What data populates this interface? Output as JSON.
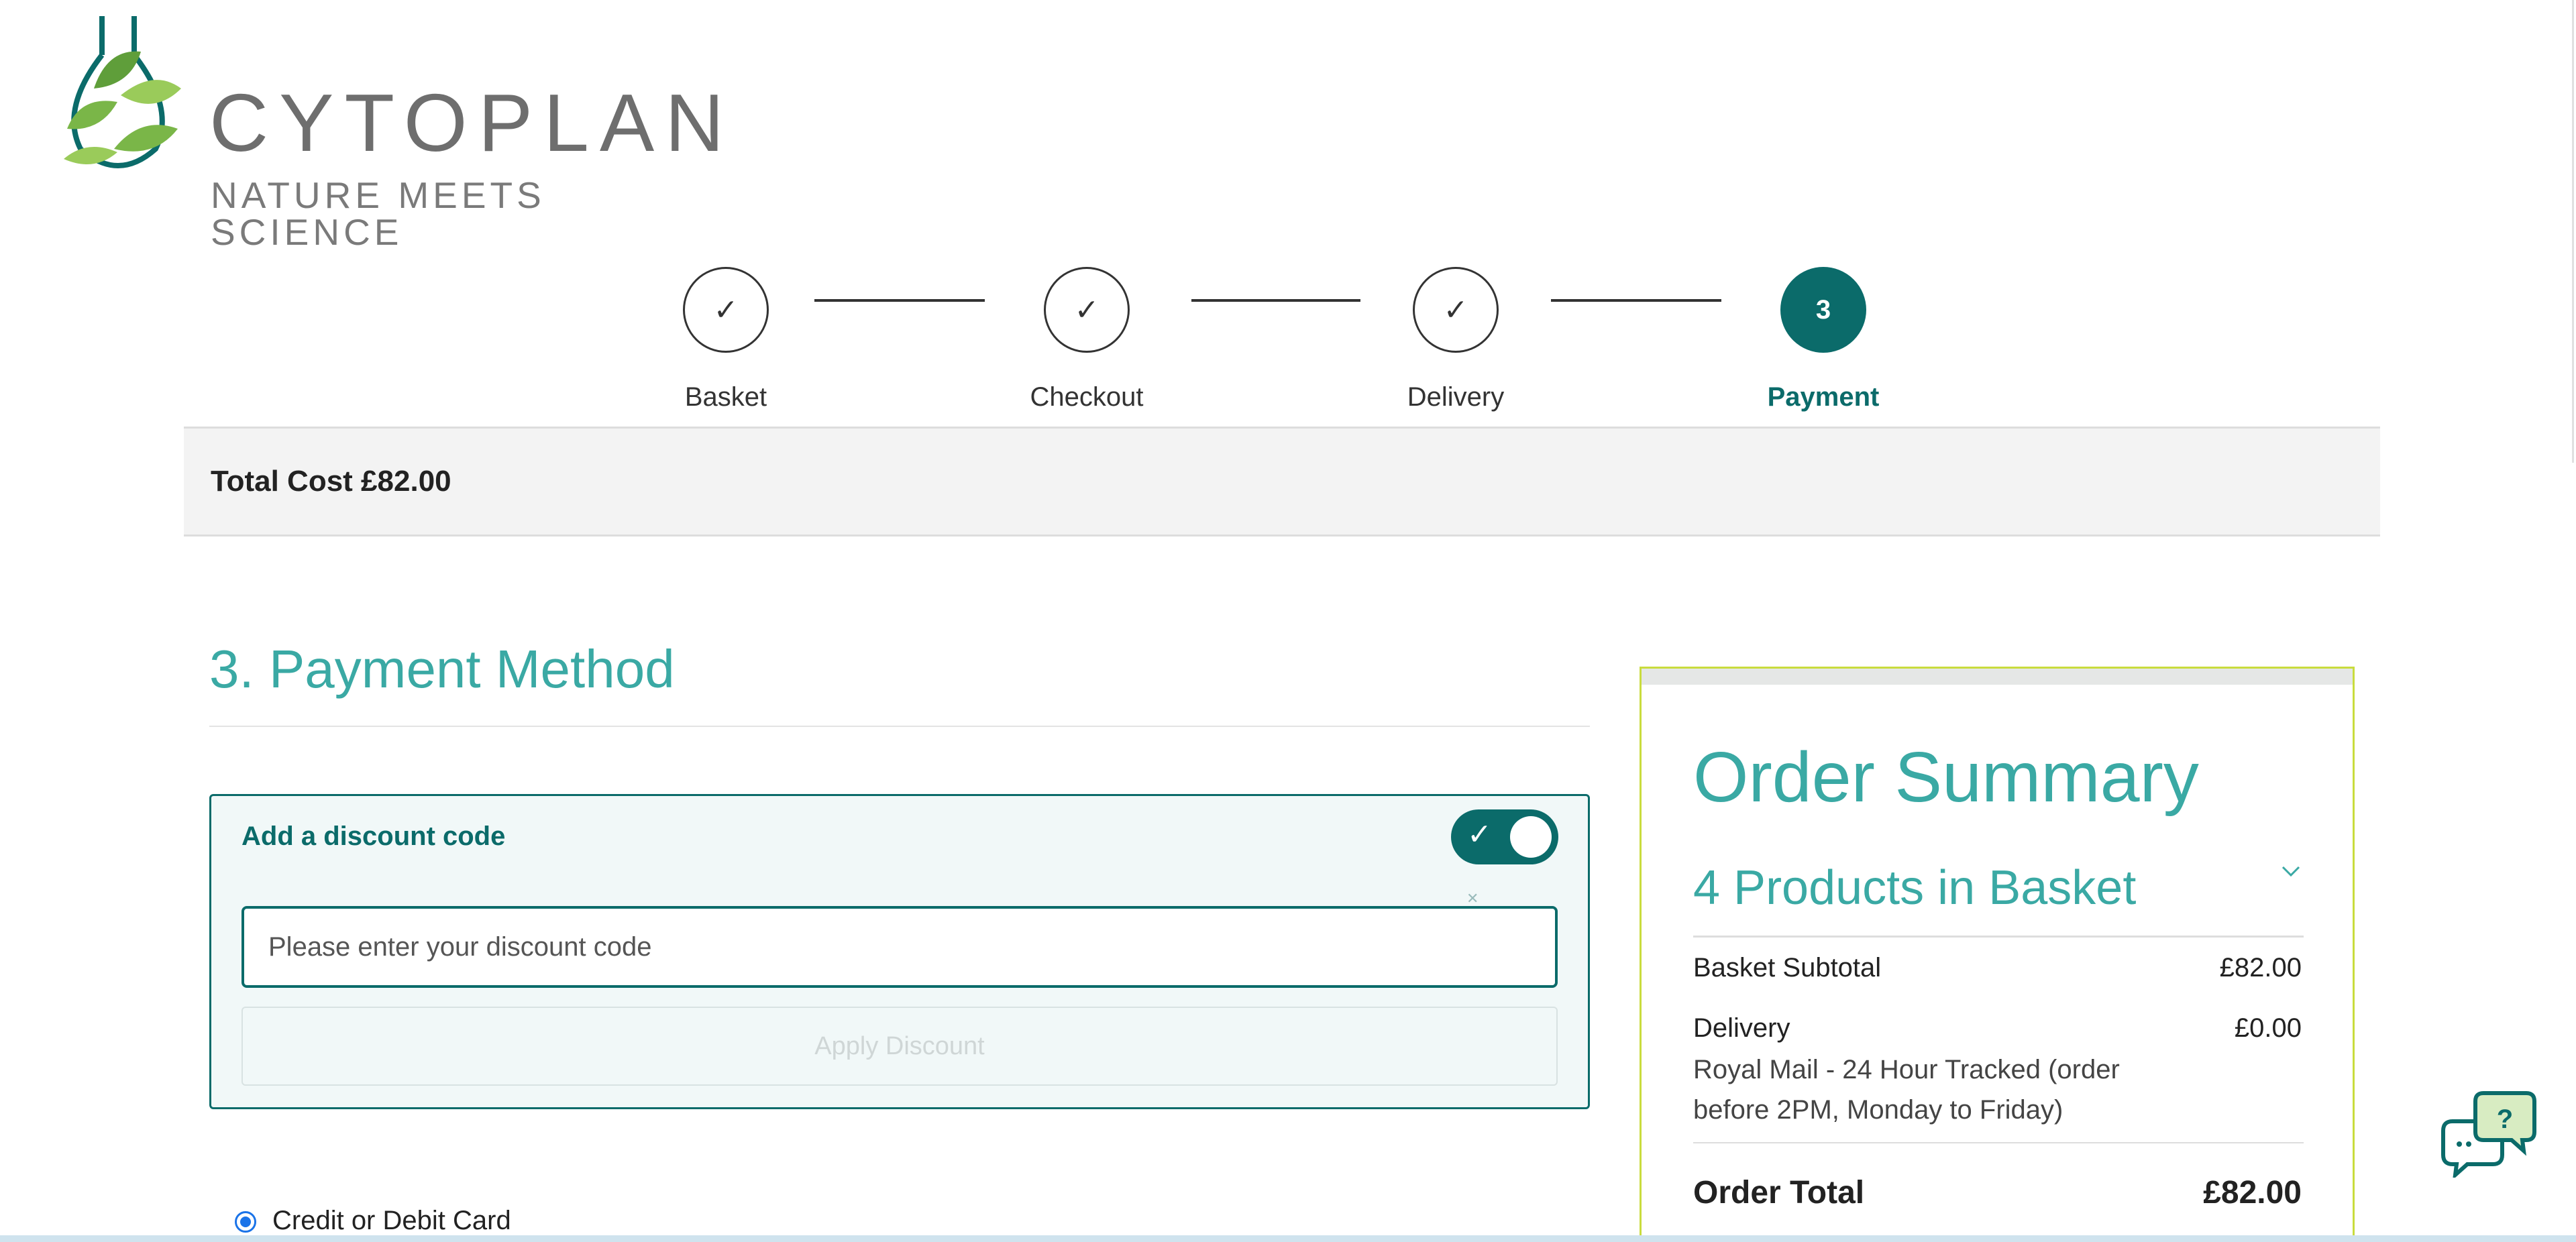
{
  "brand": {
    "name": "CYTOPLAN",
    "tagline": "NATURE MEETS SCIENCE",
    "colors": {
      "primary": "#0b6b6a",
      "accent": "#3aa9a4",
      "leaf": "#7ab648",
      "summary_border": "#c9dc3d"
    }
  },
  "stepper": {
    "steps": [
      {
        "label": "Basket",
        "icon": "check-icon",
        "mark": "✓",
        "state": "done"
      },
      {
        "label": "Checkout",
        "icon": "check-icon",
        "mark": "✓",
        "state": "done"
      },
      {
        "label": "Delivery",
        "icon": "check-icon",
        "mark": "✓",
        "state": "done"
      },
      {
        "label": "Payment",
        "mark": "3",
        "state": "active"
      }
    ]
  },
  "total_bar": {
    "text": "Total Cost £82.00"
  },
  "payment": {
    "title": "3. Payment Method",
    "discount": {
      "label": "Add a discount code",
      "toggle_on": true,
      "input_value": "",
      "placeholder": "Please enter your discount code",
      "apply_label": "Apply Discount"
    },
    "methods": [
      {
        "label": "Credit or Debit Card",
        "selected": true
      }
    ]
  },
  "summary": {
    "title": "Order Summary",
    "products_count_label": "4 Products in Basket",
    "rows": [
      {
        "label": "Basket Subtotal",
        "value": "£82.00"
      },
      {
        "label": "Delivery",
        "value": "£0.00",
        "detail": "Royal Mail - 24 Hour Tracked (order before 2PM, Monday to Friday)"
      }
    ],
    "total_label": "Order Total",
    "total_value": "£82.00"
  },
  "chat": {
    "icon": "chat-help-icon",
    "glyph": "?"
  }
}
